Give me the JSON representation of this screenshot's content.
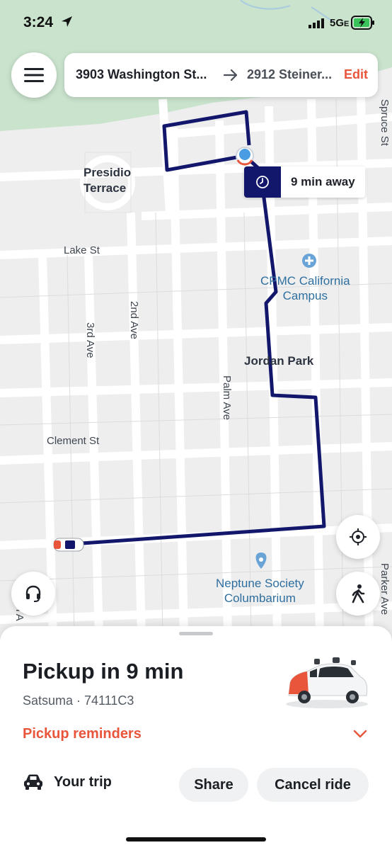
{
  "status_bar": {
    "time": "3:24",
    "network": "5G",
    "network_suffix": "E",
    "icons": [
      "location-arrow-icon",
      "signal-icon",
      "battery-charging-icon"
    ]
  },
  "route": {
    "from": "3903 Washington St...",
    "to": "2912 Steiner...",
    "edit": "Edit"
  },
  "eta": {
    "text": "9 min away",
    "icon": "clock-icon"
  },
  "map": {
    "labels": {
      "presidio_terrace": "Presidio\nTerrace",
      "lake_st": "Lake St",
      "cpmc": "CPMC California\nCampus",
      "second_ave": "2nd Ave",
      "third_ave": "3rd Ave",
      "jordan_park": "Jordan Park",
      "palm_ave": "Palm Ave",
      "clement_st": "Clement St",
      "neptune": "Neptune Society\nColumbarium",
      "spruce_st": "Spruce St",
      "parker_ave": "Parker Ave",
      "partial_ave": "n A"
    },
    "colors": {
      "route": "#12176c",
      "park": "#c9e3cd",
      "roads": "#ffffff",
      "accent": "#e9553b"
    }
  },
  "buttons": {
    "menu": "hamburger-menu-icon",
    "recenter": "crosshair-icon",
    "support": "headset-icon",
    "walk": "walking-person-icon"
  },
  "sheet": {
    "title": "Pickup in 9 min",
    "vehicle": "Satsuma · 74111C3",
    "reminders": "Pickup reminders",
    "trip": "Your trip",
    "share": "Share",
    "cancel": "Cancel ride"
  }
}
